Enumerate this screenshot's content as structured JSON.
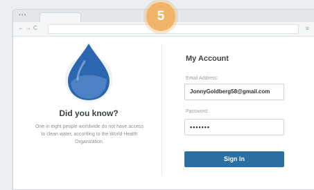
{
  "browser": {
    "dots": "•••",
    "nav_back": "←",
    "nav_forward": "→",
    "nav_reload": "C",
    "menu_icon": "≡"
  },
  "step_badge": "5",
  "fact": {
    "icon": "water-drop-icon",
    "title": "Did you know?",
    "text": "One in eight people worldwide do not have access to clean water, according to the World Health Organization."
  },
  "account": {
    "title": "My Account",
    "email_label": "Email Address:",
    "email_value": "JonnyGoldberg58@gmail.com",
    "password_label": "Password:",
    "password_value": "•••••••",
    "signin_label": "Sign In"
  },
  "colors": {
    "badge": "#f0b56a",
    "drop": "#2b67b0",
    "button": "#2b6fa3"
  }
}
